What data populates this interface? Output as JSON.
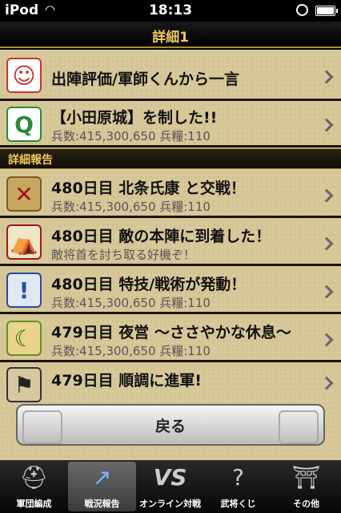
{
  "status": {
    "carrier": "iPod",
    "time": "18:13"
  },
  "header": {
    "title": "詳細1"
  },
  "items_top": [
    {
      "icon": "general-face-icon",
      "title": "出陣評価/軍師くんから一言",
      "sub": ""
    },
    {
      "icon": "q-emblem-icon",
      "title": "【小田原城】を制した!!",
      "sub": "兵数:415,300,650 兵糧:110"
    }
  ],
  "section": {
    "label": "詳細報告"
  },
  "items_report": [
    {
      "icon": "crossed-swords-icon",
      "title": "480日目 北条氏康 と交戦！",
      "sub": "兵数:415,300,650 兵糧:110"
    },
    {
      "icon": "enemy-camp-icon",
      "title": "480日目 敵の本陣に到着した！",
      "sub": "敵将首を討ち取る好機ぞ！"
    },
    {
      "icon": "exclamation-icon",
      "title": "480日目 特技/戦術が発動！",
      "sub": "兵数:415,300,650 兵糧:110"
    },
    {
      "icon": "night-camp-icon",
      "title": "479日目 夜営 〜ささやかな休息〜",
      "sub": "兵数:415,300,650 兵糧:110"
    },
    {
      "icon": "march-icon",
      "title": "479日目 順調に進軍!",
      "sub": ""
    }
  ],
  "back_button": {
    "label": "戻る"
  },
  "tabs": [
    {
      "label": "軍団編成",
      "icon": "helmet-icon",
      "active": false
    },
    {
      "label": "戦況報告",
      "icon": "spear-icon",
      "active": true
    },
    {
      "label": "オンライン対戦",
      "icon": "vs-icon",
      "active": false
    },
    {
      "label": "武将くじ",
      "icon": "question-icon",
      "active": false
    },
    {
      "label": "その他",
      "icon": "temple-icon",
      "active": false
    }
  ]
}
